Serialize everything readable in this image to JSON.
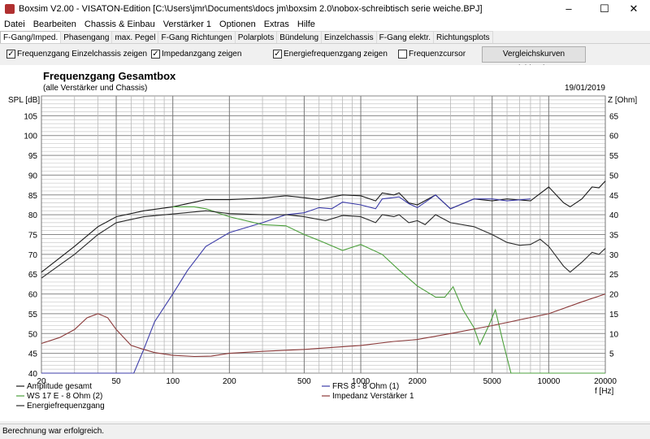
{
  "window": {
    "title": "Boxsim V2.00 - VISATON-Edition [C:\\Users\\jmr\\Documents\\docs jm\\boxsim 2.0\\nobox-schreibtisch serie weiche.BPJ]",
    "minimize": "–",
    "maximize": "☐",
    "close": "✕"
  },
  "menu": [
    "Datei",
    "Bearbeiten",
    "Chassis & Einbau",
    "Verstärker 1",
    "Optionen",
    "Extras",
    "Hilfe"
  ],
  "tabs": [
    "F-Gang/Imped.",
    "Phasengang",
    "max. Pegel",
    "F-Gang Richtungen",
    "Polarplots",
    "Bündelung",
    "Einzelchassis",
    "F-Gang elektr.",
    "Richtungsplots"
  ],
  "options": {
    "cb1": {
      "label": "Frequenzgang Einzelchassis zeigen",
      "checked": true
    },
    "cb2": {
      "label": "Impedanzgang zeigen",
      "checked": true
    },
    "cb3": {
      "label": "Energiefrequenzgang zeigen",
      "checked": true
    },
    "cb4": {
      "label": "Frequenzcursor",
      "checked": false
    },
    "compare_button": "Vergleichskurven einblenden"
  },
  "status": "Berechnung war erfolgreich.",
  "chart_data": {
    "type": "line",
    "title": "Frequenzgang Gesamtbox",
    "subtitle": "(alle Verstärker und Chassis)",
    "date": "19/01/2019",
    "ylabel": "SPL [dB]",
    "y2label": "Z [Ohm]",
    "xlabel": "f [Hz]",
    "xscale": "log",
    "xlim": [
      20,
      20000
    ],
    "ylim": [
      40,
      110
    ],
    "y2lim": [
      0,
      70
    ],
    "xticks": [
      20,
      50,
      100,
      200,
      500,
      1000,
      2000,
      5000,
      10000,
      20000
    ],
    "yticks": [
      40,
      45,
      50,
      55,
      60,
      65,
      70,
      75,
      80,
      85,
      90,
      95,
      100,
      105
    ],
    "y2ticks": [
      5,
      10,
      15,
      20,
      25,
      30,
      35,
      40,
      45,
      50,
      55,
      60,
      65
    ],
    "series": [
      {
        "name": "Amplitude gesamt",
        "color": "#1a1a1a",
        "axis": "left",
        "points": [
          [
            20,
            65.5
          ],
          [
            30,
            72
          ],
          [
            40,
            77
          ],
          [
            50,
            79.5
          ],
          [
            70,
            81
          ],
          [
            100,
            82
          ],
          [
            150,
            83.8
          ],
          [
            200,
            83.8
          ],
          [
            300,
            84.2
          ],
          [
            400,
            84.8
          ],
          [
            500,
            84.3
          ],
          [
            600,
            83.8
          ],
          [
            800,
            85
          ],
          [
            1000,
            84.8
          ],
          [
            1200,
            83.5
          ],
          [
            1300,
            85.5
          ],
          [
            1500,
            85
          ],
          [
            1600,
            85.5
          ],
          [
            1800,
            83
          ],
          [
            2000,
            82.5
          ],
          [
            2500,
            85
          ],
          [
            3000,
            81.5
          ],
          [
            4000,
            84
          ],
          [
            5000,
            83.5
          ],
          [
            6000,
            84
          ],
          [
            8000,
            83.5
          ],
          [
            10000,
            87
          ],
          [
            12000,
            83
          ],
          [
            13000,
            82
          ],
          [
            15000,
            84
          ],
          [
            17000,
            87
          ],
          [
            18500,
            86.8
          ],
          [
            20000,
            88.5
          ]
        ]
      },
      {
        "name": "FRS 8 - 8 Ohm (1)",
        "color": "#3c3ca8",
        "axis": "left",
        "points": [
          [
            20,
            40
          ],
          [
            62,
            40
          ],
          [
            70,
            46
          ],
          [
            80,
            53
          ],
          [
            100,
            60
          ],
          [
            120,
            66
          ],
          [
            150,
            72
          ],
          [
            200,
            75.5
          ],
          [
            300,
            78
          ],
          [
            400,
            80
          ],
          [
            500,
            80.5
          ],
          [
            600,
            81.8
          ],
          [
            700,
            81.5
          ],
          [
            800,
            83.2
          ],
          [
            1000,
            82.5
          ],
          [
            1200,
            81.5
          ],
          [
            1300,
            84
          ],
          [
            1600,
            84.5
          ],
          [
            1800,
            82.8
          ],
          [
            2000,
            81.8
          ],
          [
            2500,
            85
          ],
          [
            3000,
            81.5
          ],
          [
            4000,
            84
          ],
          [
            5000,
            84
          ],
          [
            6000,
            83.5
          ],
          [
            8000,
            84
          ]
        ]
      },
      {
        "name": "WS 17 E - 8 Ohm   (2)",
        "color": "#4ca03c",
        "axis": "left",
        "points": [
          [
            100,
            82
          ],
          [
            130,
            82
          ],
          [
            150,
            81.5
          ],
          [
            200,
            79.5
          ],
          [
            300,
            77.5
          ],
          [
            400,
            77.2
          ],
          [
            500,
            75
          ],
          [
            600,
            73.5
          ],
          [
            800,
            71
          ],
          [
            1000,
            72.5
          ],
          [
            1300,
            70
          ],
          [
            1600,
            66
          ],
          [
            2000,
            62
          ],
          [
            2500,
            59.2
          ],
          [
            2800,
            59.2
          ],
          [
            3100,
            61.8
          ],
          [
            3500,
            56
          ],
          [
            4000,
            51.5
          ],
          [
            4300,
            47.2
          ],
          [
            4800,
            52
          ],
          [
            5200,
            56
          ],
          [
            5700,
            48
          ],
          [
            6300,
            40
          ],
          [
            20000,
            40
          ]
        ]
      },
      {
        "name": "Energiefrequenzgang",
        "color": "#2a2a2a",
        "axis": "left",
        "points": [
          [
            20,
            64
          ],
          [
            30,
            70
          ],
          [
            40,
            75
          ],
          [
            50,
            78
          ],
          [
            70,
            79.5
          ],
          [
            100,
            80.2
          ],
          [
            150,
            81
          ],
          [
            200,
            80.3
          ],
          [
            300,
            80
          ],
          [
            400,
            80
          ],
          [
            500,
            79.5
          ],
          [
            650,
            78.5
          ],
          [
            800,
            79.8
          ],
          [
            1000,
            79.5
          ],
          [
            1200,
            78
          ],
          [
            1300,
            80
          ],
          [
            1500,
            79.5
          ],
          [
            1600,
            80
          ],
          [
            1800,
            78
          ],
          [
            2000,
            78.5
          ],
          [
            2200,
            77.5
          ],
          [
            2500,
            80
          ],
          [
            3000,
            78
          ],
          [
            4000,
            77
          ],
          [
            5000,
            75
          ],
          [
            6000,
            73
          ],
          [
            7000,
            72.3
          ],
          [
            8000,
            72.5
          ],
          [
            9000,
            73.8
          ],
          [
            10000,
            72
          ],
          [
            12000,
            67
          ],
          [
            13000,
            65.5
          ],
          [
            15000,
            68
          ],
          [
            17000,
            70.5
          ],
          [
            18500,
            70
          ],
          [
            20000,
            71.5
          ]
        ]
      },
      {
        "name": "Impedanz Verstärker 1",
        "color": "#8b3a3a",
        "axis": "right",
        "points": [
          [
            20,
            7.5
          ],
          [
            25,
            9
          ],
          [
            30,
            11
          ],
          [
            35,
            14
          ],
          [
            40,
            15
          ],
          [
            45,
            14
          ],
          [
            50,
            11
          ],
          [
            60,
            7
          ],
          [
            70,
            6
          ],
          [
            80,
            5.2
          ],
          [
            100,
            4.5
          ],
          [
            130,
            4.2
          ],
          [
            160,
            4.3
          ],
          [
            200,
            5
          ],
          [
            300,
            5.5
          ],
          [
            500,
            6
          ],
          [
            1000,
            7
          ],
          [
            1500,
            8
          ],
          [
            2000,
            8.5
          ],
          [
            3000,
            10
          ],
          [
            5000,
            12
          ],
          [
            10000,
            15
          ],
          [
            15000,
            18
          ],
          [
            20000,
            20
          ]
        ]
      }
    ],
    "legend": {
      "placement": "bottom",
      "items": [
        0,
        1,
        2,
        4,
        3
      ]
    },
    "grid": true
  }
}
